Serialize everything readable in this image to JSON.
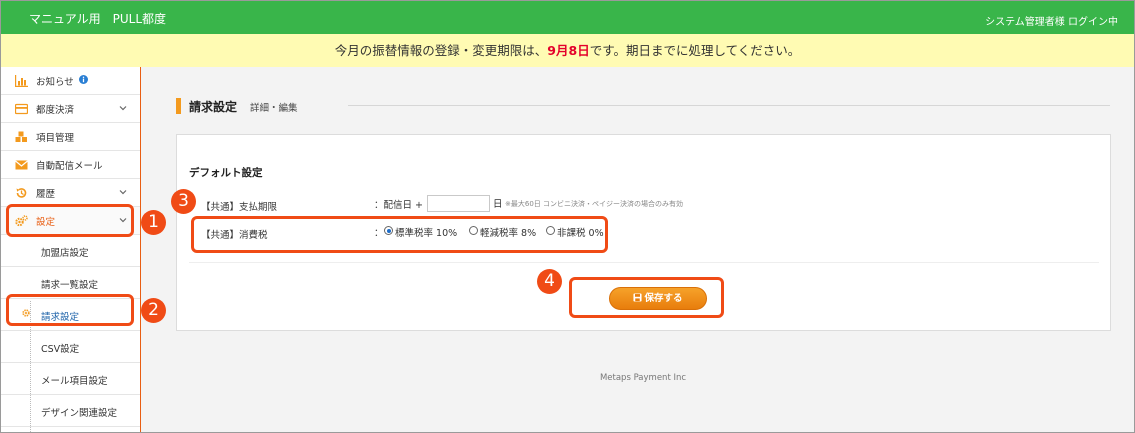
{
  "header": {
    "title": "マニュアル用　PULL都度",
    "user_status": "システム管理者様 ログイン中"
  },
  "notice": {
    "prefix": "今月の振替情報の登録・変更期限は、",
    "deadline": "9月8日",
    "suffix": "です。期日までに処理してください。"
  },
  "sidebar": {
    "items": [
      {
        "label": "お知らせ",
        "icon": "chart-bar-icon",
        "badge": "info-icon"
      },
      {
        "label": "都度決済",
        "icon": "credit-card-icon"
      },
      {
        "label": "項目管理",
        "icon": "cubes-icon"
      },
      {
        "label": "自動配信メール",
        "icon": "envelope-icon"
      },
      {
        "label": "履歴",
        "icon": "history-icon"
      },
      {
        "label": "設定",
        "icon": "gears-icon"
      }
    ],
    "sub_items": [
      {
        "label": "加盟店設定"
      },
      {
        "label": "請求一覧設定"
      },
      {
        "label": "請求設定"
      },
      {
        "label": "CSV設定"
      },
      {
        "label": "メール項目設定"
      },
      {
        "label": "デザイン関連設定"
      }
    ]
  },
  "page": {
    "title": "請求設定",
    "subtitle": "詳細・編集"
  },
  "form": {
    "section_title": "デフォルト設定",
    "payment_label": "【共通】支払期限",
    "payment_prefix": "：配信日 +",
    "payment_value": "",
    "payment_unit": "日",
    "payment_hint": "※最大60日 コンビニ決済・ペイジー決済の場合のみ有効",
    "tax_label": "【共通】消費税",
    "tax_colon": "：",
    "tax_options": [
      {
        "label": "標準税率 10%",
        "checked": true
      },
      {
        "label": "軽減税率 8%",
        "checked": false
      },
      {
        "label": "非課税 0%",
        "checked": false
      }
    ],
    "save_label": "保存する"
  },
  "footer": {
    "text": "Metaps Payment Inc"
  },
  "annotations": [
    "1",
    "2",
    "3",
    "4"
  ],
  "colors": {
    "header_green": "#39b54a",
    "notice_yellow": "#fffbb3",
    "accent_orange": "#f39a1e",
    "annotation_red": "#f04b16",
    "deadline_red": "#e4002b"
  }
}
